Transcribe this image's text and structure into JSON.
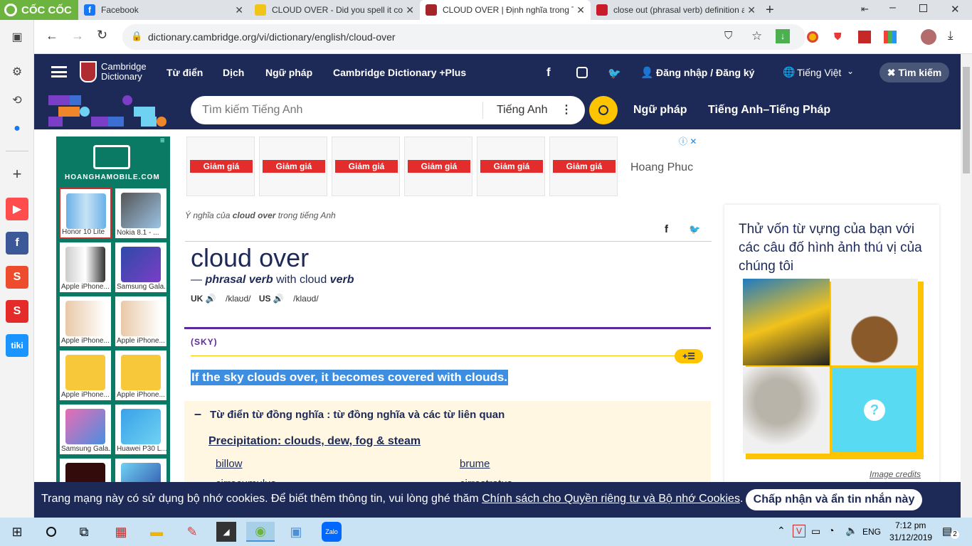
{
  "browser": {
    "tabs": [
      {
        "title": "Facebook"
      },
      {
        "title": "CLOUD OVER - Did you spell it corre"
      },
      {
        "title": "CLOUD OVER | Định nghĩa trong Từ đi"
      },
      {
        "title": "close out (phrasal verb) definition an"
      }
    ],
    "brand": "CỐC CỐC",
    "url": "dictionary.cambridge.org/vi/dictionary/english/cloud-over"
  },
  "site": {
    "logo_line1": "Cambridge",
    "logo_line2": "Dictionary",
    "nav": [
      "Từ điển",
      "Dịch",
      "Ngữ pháp",
      "Cambridge Dictionary +Plus"
    ],
    "login": "Đăng nhập / Đăng ký",
    "language": "Tiếng Việt",
    "search_button": "Tìm kiếm",
    "search_placeholder": "Tìm kiếm Tiếng Anh",
    "search_lang": "Tiếng Anh",
    "subnav": [
      "Ngữ pháp",
      "Tiếng Anh–Tiếng Pháp"
    ]
  },
  "ad_left": {
    "site": "HOANGHAMOBILE.COM",
    "phones": [
      "Honor 10 Lite",
      "Nokia 8.1 - ...",
      "Apple iPhone...",
      "Samsung Gala...",
      "Apple iPhone...",
      "Apple iPhone...",
      "Apple iPhone...",
      "Apple iPhone...",
      "Samsung Gala...",
      "Huawei P30 L..."
    ]
  },
  "ad_top": {
    "sale_label": "Giảm giá",
    "brand": "Hoang Phuc"
  },
  "entry": {
    "meaning_prefix": "Ý nghĩa của",
    "meaning_word": "cloud over",
    "meaning_suffix": "trong tiếng Anh",
    "headword": "cloud over",
    "pos_dash": "—",
    "pos": "phrasal verb",
    "pos_with": "with cloud",
    "pos_verb": "verb",
    "uk_label": "UK",
    "uk_ipa": "/klaʊd/",
    "us_label": "US",
    "us_ipa": "/klaʊd/",
    "sense": "(SKY)",
    "definition": "If the sky clouds over, it becomes covered with clouds.",
    "thesaurus_title": "Từ điển từ đồng nghĩa : từ đồng nghĩa và các từ liên quan",
    "thesaurus_link": "Precipitation: clouds, dew, fog & steam",
    "related": [
      "billow",
      "brume",
      "cirrocumulus",
      "cirrostratus"
    ]
  },
  "quiz": {
    "heading": "Thử vốn từ vựng của bạn với các câu đố hình ảnh thú vị của chúng tôi",
    "credits": "Image credits"
  },
  "cookie": {
    "text": "Trang mạng này có sử dụng bộ nhớ cookies. Để biết thêm thông tin, vui lòng ghé thăm",
    "link": "Chính sách cho Quyền riêng tư và Bộ nhớ Cookies",
    "period": ".",
    "button": "Chấp nhận và ẩn tin nhắn này"
  },
  "taskbar": {
    "lang": "ENG",
    "time": "7:12 pm",
    "date": "31/12/2019",
    "notif": "2"
  }
}
